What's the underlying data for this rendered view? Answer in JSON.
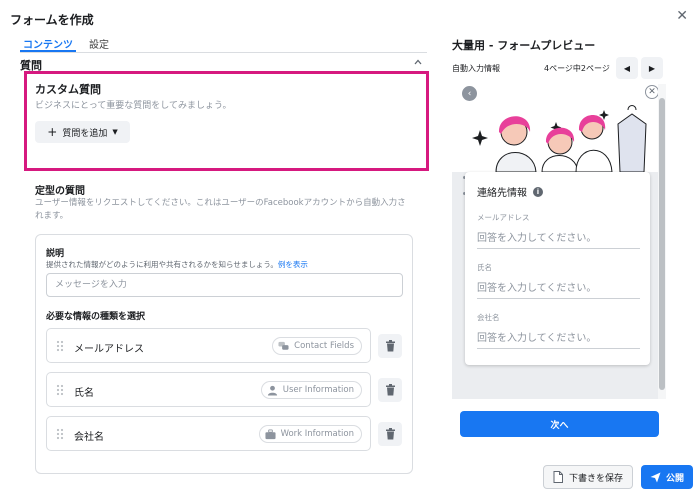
{
  "dialog": {
    "title": "フォームを作成",
    "close_icon": "close-icon",
    "close_glyph": "✕"
  },
  "tabs": [
    {
      "label": "コンテンツ",
      "active": true
    },
    {
      "label": "設定",
      "active": false
    }
  ],
  "questions": {
    "section_title": "質問",
    "custom": {
      "title": "カスタム質問",
      "subtitle": "ビジネスにとって重要な質問をしてみましょう。",
      "add_button": "質問を追加"
    },
    "standard": {
      "title": "定型の質問",
      "description": "ユーザー情報をリクエストしてください。これはユーザーのFacebookアカウントから自動入力されます。",
      "explanation_label": "説明",
      "explanation_help": "提供された情報がどのように利用や共有されるかを知らせましょう。",
      "example_link": "例を表示",
      "message_placeholder": "メッセージを入力",
      "required_label": "必要な情報の種類を選択",
      "fields": [
        {
          "name": "メールアドレス",
          "badge": "Contact Fields",
          "badge_icon": "chat-bubbles-icon"
        },
        {
          "name": "氏名",
          "badge": "User Information",
          "badge_icon": "person-icon"
        },
        {
          "name": "会社名",
          "badge": "Work Information",
          "badge_icon": "briefcase-icon"
        }
      ]
    }
  },
  "preview": {
    "title": "大量用 - フォームプレビュー",
    "autofill_label": "自動入力情報",
    "page_indicator": "4ページ中2ページ",
    "prev_glyph": "◀",
    "next_glyph": "▶",
    "back_glyph": "‹",
    "close_glyph": "✕",
    "card_title": "連絡先情報",
    "info_glyph": "i",
    "fields": [
      {
        "label": "メールアドレス",
        "placeholder": "回答を入力してください。"
      },
      {
        "label": "氏名",
        "placeholder": "回答を入力してください。"
      },
      {
        "label": "会社名",
        "placeholder": "回答を入力してください。"
      }
    ],
    "next_button": "次へ"
  },
  "footer": {
    "save_draft": "下書きを保存",
    "publish": "公開"
  },
  "colors": {
    "accent": "#1877f2",
    "highlight_border": "#d6197f",
    "illustration_pink": "#e8409a",
    "illustration_skin": "#f6c9b8"
  }
}
